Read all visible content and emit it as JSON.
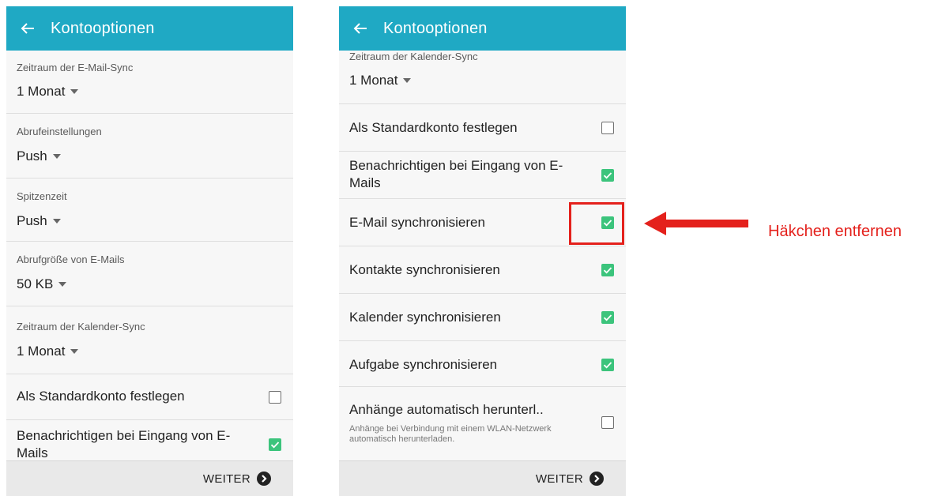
{
  "screens": [
    {
      "title": "Kontooptionen",
      "settings": [
        {
          "label": "Zeitraum der E-Mail-Sync",
          "value": "1 Monat"
        },
        {
          "label": "Abrufeinstellungen",
          "value": "Push"
        },
        {
          "label": "Spitzenzeit",
          "value": "Push"
        },
        {
          "label": "Abrufgröße von E-Mails",
          "value": "50 KB"
        },
        {
          "label": "Zeitraum der Kalender-Sync",
          "value": "1 Monat"
        }
      ],
      "checks": [
        {
          "label": "Als Standardkonto festlegen",
          "checked": false
        },
        {
          "label": "Benachrichtigen bei Eingang von E-Mails",
          "checked": true
        }
      ],
      "next_label": "WEITER"
    },
    {
      "title": "Kontooptionen",
      "settings": [
        {
          "label": "Zeitraum der Kalender-Sync",
          "value": "1 Monat"
        }
      ],
      "checks": [
        {
          "label": "Als Standardkonto festlegen",
          "checked": false
        },
        {
          "label": "Benachrichtigen bei Eingang von E-Mails",
          "checked": true
        },
        {
          "label": "E-Mail synchronisieren",
          "checked": true
        },
        {
          "label": "Kontakte synchronisieren",
          "checked": true
        },
        {
          "label": "Kalender synchronisieren",
          "checked": true
        },
        {
          "label": "Aufgabe synchronisieren",
          "checked": true
        },
        {
          "label": "Anhänge automatisch herunterl..",
          "sublabel": "Anhänge bei Verbindung mit einem WLAN-Netzwerk automatisch herunterladen.",
          "checked": false
        }
      ],
      "next_label": "WEITER"
    }
  ],
  "annotation": {
    "text": "Häkchen entfernen",
    "color": "#e4211c"
  },
  "colors": {
    "app_bar": "#1fa9c4",
    "checkbox_checked": "#3cc47c",
    "footer": "#e9e9e9"
  }
}
